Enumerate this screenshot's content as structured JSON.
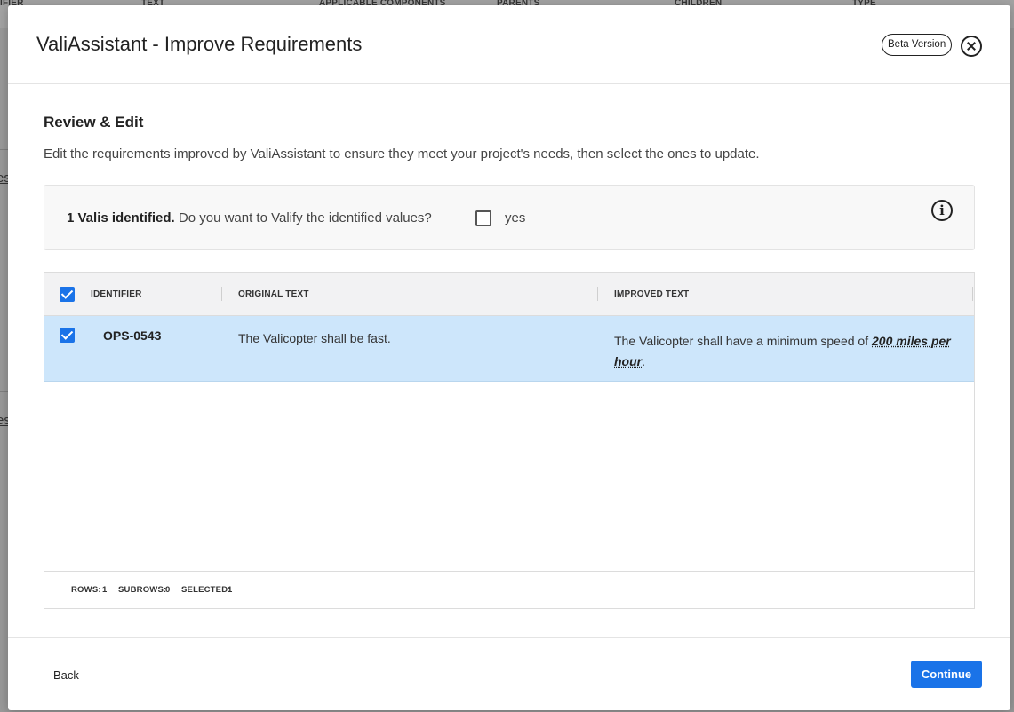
{
  "background": {
    "columns": [
      "IFIER",
      "TEXT",
      "APPLICABLE COMPONENTS",
      "PARENTS",
      "CHILDREN",
      "TYPE"
    ],
    "links": [
      "es",
      "es"
    ]
  },
  "modal": {
    "title": "ValiAssistant - Improve Requirements",
    "badge": "Beta Version",
    "section_title": "Review & Edit",
    "section_desc": "Edit the requirements improved by ValiAssistant to ensure they meet your project's needs, then select the ones to update.",
    "valis": {
      "count_text": "1 Valis identified.",
      "question": " Do you want to Valify the identified values?",
      "yes_label": "yes",
      "checked": false
    },
    "grid": {
      "headers": {
        "identifier": "IDENTIFIER",
        "original": "ORIGINAL TEXT",
        "improved": "IMPROVED TEXT"
      },
      "rows": [
        {
          "identifier": "OPS-0543",
          "original": "The Valicopter shall be fast.",
          "improved_prefix": "The Valicopter shall have a minimum speed of ",
          "improved_vali": "200 miles per hour",
          "improved_suffix": ".",
          "selected": true
        }
      ],
      "footer": {
        "rows_label": "ROWS:",
        "rows": "1",
        "subrows_label": "SUBROWS:",
        "subrows": "0",
        "selected_label": "SELECTED:",
        "selected": "1"
      }
    },
    "footer": {
      "back": "Back",
      "continue": "Continue"
    }
  },
  "colors": {
    "primary": "#1a73e8",
    "row_selected": "#cde6fb"
  }
}
